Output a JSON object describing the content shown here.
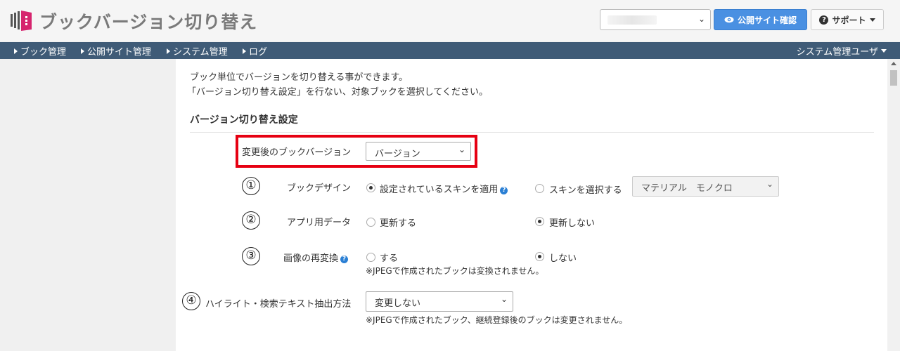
{
  "header": {
    "title": "ブックバージョン切り替え",
    "site_select_value": "",
    "public_site_button": "公開サイト確認",
    "support_button": "サポート"
  },
  "nav": {
    "items": [
      "ブック管理",
      "公開サイト管理",
      "システム管理",
      "ログ"
    ],
    "user_menu": "システム管理ユーザ"
  },
  "content": {
    "intro_line1": "ブック単位でバージョンを切り替える事ができます。",
    "intro_line2": "「バージョン切り替え設定」を行ない、対象ブックを選択してください。",
    "section_title": "バージョン切り替え設定",
    "version": {
      "label": "変更後のブックバージョン",
      "value": "バージョン"
    },
    "design": {
      "number": "①",
      "label": "ブックデザイン",
      "option1": "設定されているスキンを適用",
      "option2": "スキンを選択する",
      "skin_value": "マテリアル　モノクロ"
    },
    "appdata": {
      "number": "②",
      "label": "アプリ用データ",
      "option1": "更新する",
      "option2": "更新しない"
    },
    "reconvert": {
      "number": "③",
      "label": "画像の再変換",
      "option1": "する",
      "option2": "しない",
      "note": "※JPEGで作成されたブックは変換されません。"
    },
    "extraction": {
      "number": "④",
      "label": "ハイライト・検索テキスト抽出方法",
      "value": "変更しない",
      "note": "※JPEGで作成されたブック、継続登録後のブックは変更されません。"
    }
  },
  "colors": {
    "nav_bg": "#3f5b77",
    "primary_button": "#4a90e2",
    "highlight_border": "#e60012",
    "logo": "#d6246e"
  }
}
